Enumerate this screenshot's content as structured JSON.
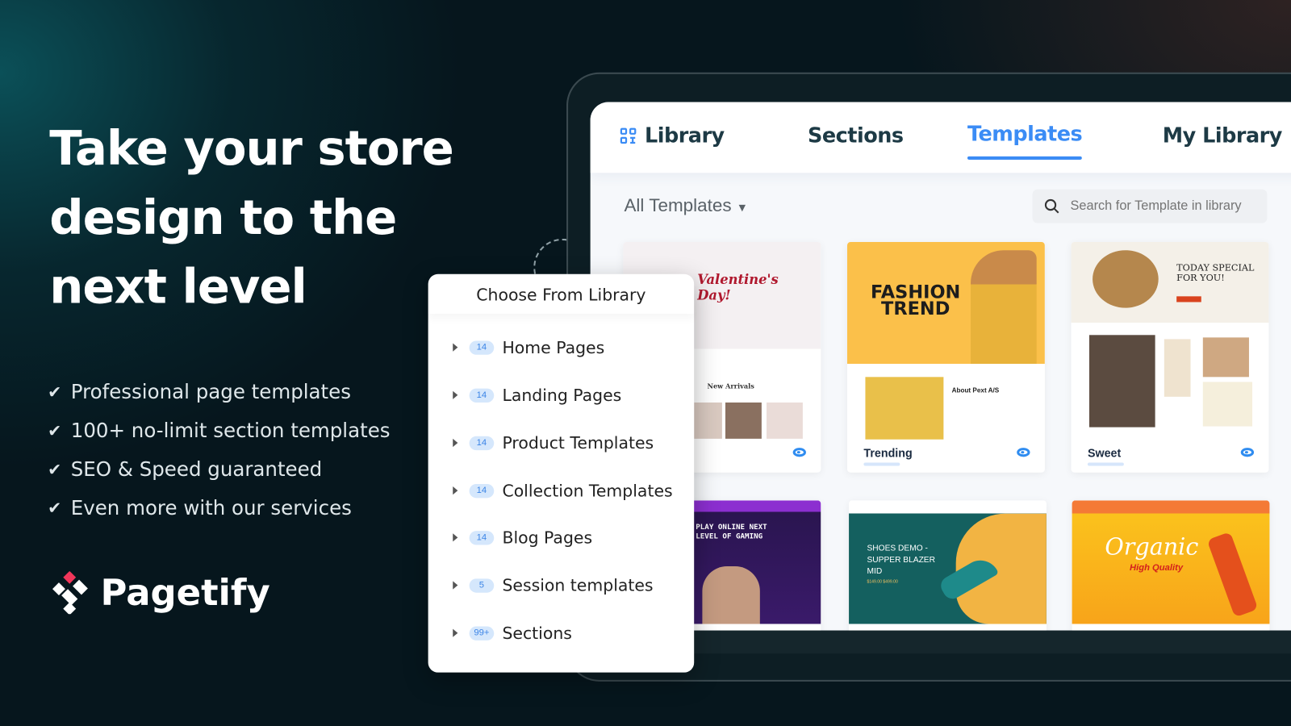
{
  "hero": {
    "headline_lines": [
      "Take your store",
      "design to the",
      "next level"
    ],
    "features": [
      "Professional page templates",
      "100+ no-limit section templates",
      "SEO & Speed guaranteed",
      "Even more with our services"
    ]
  },
  "brand": {
    "name": "Pagetify",
    "accent": "#f0365a"
  },
  "app": {
    "tabs": [
      {
        "label": "Library",
        "icon": "grid-icon"
      },
      {
        "label": "Sections"
      },
      {
        "label": "Templates",
        "active": true
      },
      {
        "label": "My Library"
      }
    ],
    "filter": {
      "label": "All Templates"
    },
    "search": {
      "placeholder": "Search for Template in library"
    },
    "cards": [
      {
        "label": "",
        "thumb_title": "Valentine's Day!",
        "thumb_sub": "New Arrivals"
      },
      {
        "label": "Trending",
        "thumb_title": "FASHION TREND",
        "thumb_sub": "About Pext A/S"
      },
      {
        "label": "Sweet",
        "thumb_title": "TODAY SPECIAL FOR YOU!"
      },
      {
        "thumb_title": "PLAY ONLINE NEXT LEVEL OF GAMING"
      },
      {
        "thumb_title": "SHOES DEMO - SUPPER BLAZER MID",
        "thumb_price": "$149.00 $499.00"
      },
      {
        "thumb_title": "Organic",
        "thumb_sub": "High Quality"
      }
    ],
    "accent": "#3b8cf5"
  },
  "popup": {
    "title": "Choose From Library",
    "items": [
      {
        "count": "14",
        "label": "Home Pages"
      },
      {
        "count": "14",
        "label": "Landing Pages"
      },
      {
        "count": "14",
        "label": "Product Templates"
      },
      {
        "count": "14",
        "label": "Collection Templates"
      },
      {
        "count": "14",
        "label": "Blog Pages"
      },
      {
        "count": "5",
        "label": "Session templates"
      },
      {
        "count": "99+",
        "label": "Sections"
      }
    ]
  }
}
